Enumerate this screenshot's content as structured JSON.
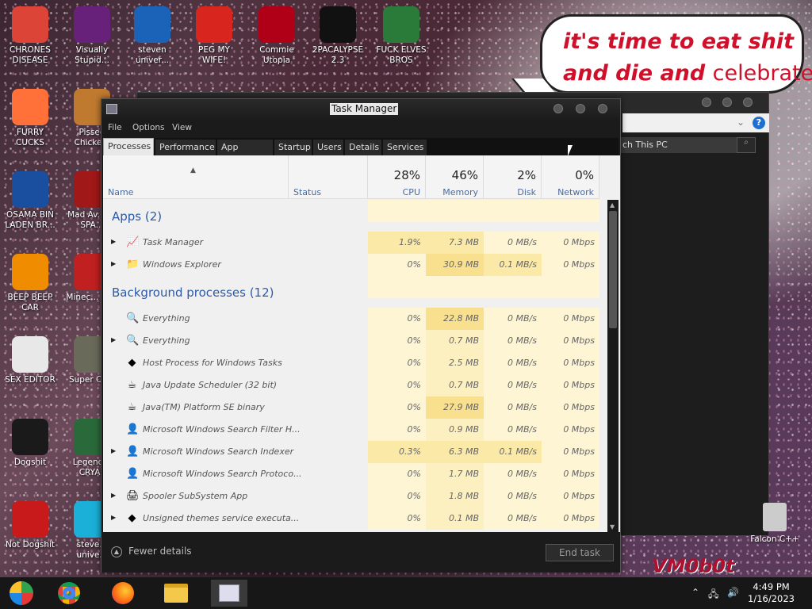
{
  "desktop": {
    "icons": [
      {
        "label": "CHRONES DISEASE",
        "color": "#db4437",
        "glyph": "chrome-icon"
      },
      {
        "label": "Visually Stupid...",
        "color": "#68217a",
        "glyph": "visual-studio-icon"
      },
      {
        "label": "steven univer...",
        "color": "#1a63b8",
        "glyph": "game-icon"
      },
      {
        "label": "PEG MY WIFE!",
        "color": "#d8261e",
        "glyph": "peggle-icon"
      },
      {
        "label": "Commie Utopia",
        "color": "#b00018",
        "glyph": "star-icon"
      },
      {
        "label": "2PACALYPSE 2.3",
        "color": "#111111",
        "glyph": "cmd-icon"
      },
      {
        "label": "FUCK ELVES BROS",
        "color": "#2a7a3a",
        "glyph": "elf-icon"
      },
      {
        "label": "FURRY CUCKS",
        "color": "#ff7139",
        "glyph": "firefox-icon"
      },
      {
        "label": "Pissed Chicke...",
        "color": "#c07a30",
        "glyph": "chicken-icon"
      },
      {
        "label": "OSAMA BIN LADEN BR...",
        "color": "#1a4fa0",
        "glyph": "obama-logo-icon"
      },
      {
        "label": "Mad Av... IN SPA...",
        "color": "#a01818",
        "glyph": "angry-birds-icon"
      },
      {
        "label": "BEEP BEEP CAR",
        "color": "#f08c00",
        "glyph": "vlc-icon"
      },
      {
        "label": "Minec... Bird",
        "color": "#c02020",
        "glyph": "bird-icon"
      },
      {
        "label": "SEX EDITOR",
        "color": "#e8e8e8",
        "glyph": "hxd-icon"
      },
      {
        "label": "Super Ch...",
        "color": "#6a6a5a",
        "glyph": "pixel-icon"
      },
      {
        "label": "Dogshit",
        "color": "#1a1a1a",
        "glyph": "codeblocks-icon"
      },
      {
        "label": "Legend... CRYAL",
        "color": "#2a6a3a",
        "glyph": "zelda-icon"
      },
      {
        "label": "Not Dogshit",
        "color": "#c81a1a",
        "glyph": "devcpp-icon"
      },
      {
        "label": "steve... unive...",
        "color": "#1ab0d8",
        "glyph": "gem-icon"
      }
    ],
    "bubble": {
      "line1": "it's time to eat shit",
      "line2a": "and die and ",
      "line2b": "celebrate"
    },
    "overlay_text": "VM0b0t",
    "falcon_label": "Falcon C++",
    "explorer": {
      "search_placeholder": "ch This PC",
      "search_btn": "⌕",
      "help": "?",
      "chevron": "⌄"
    }
  },
  "taskmanager": {
    "title": "Task Manager",
    "menu": [
      "File",
      "Options",
      "View"
    ],
    "tabs": [
      "Processes",
      "Performance",
      "App history",
      "Startup",
      "Users",
      "Details",
      "Services"
    ],
    "active_tab": "Processes",
    "columns": {
      "name": "Name",
      "status": "Status",
      "cpu": {
        "pct": "28%",
        "label": "CPU"
      },
      "memory": {
        "pct": "46%",
        "label": "Memory"
      },
      "disk": {
        "pct": "2%",
        "label": "Disk"
      },
      "network": {
        "pct": "0%",
        "label": "Network"
      }
    },
    "groups": [
      {
        "title": "Apps (2)",
        "rows": [
          {
            "expand": "▶",
            "icon": "taskmgr-icon",
            "glyph": "📈",
            "name": "Task Manager",
            "cpu": "1.9%",
            "mem": "7.3 MB",
            "disk": "0 MB/s",
            "net": "0 Mbps"
          },
          {
            "expand": "▶",
            "icon": "folder-icon",
            "glyph": "📁",
            "name": "Windows Explorer",
            "cpu": "0%",
            "mem": "30.9 MB",
            "disk": "0.1 MB/s",
            "net": "0 Mbps"
          }
        ]
      },
      {
        "title": "Background processes (12)",
        "rows": [
          {
            "expand": "",
            "icon": "magnifier-icon",
            "glyph": "🔍",
            "name": "Everything",
            "cpu": "0%",
            "mem": "22.8 MB",
            "disk": "0 MB/s",
            "net": "0 Mbps"
          },
          {
            "expand": "▶",
            "icon": "magnifier-icon",
            "glyph": "🔍",
            "name": "Everything",
            "cpu": "0%",
            "mem": "0.7 MB",
            "disk": "0 MB/s",
            "net": "0 Mbps"
          },
          {
            "expand": "",
            "icon": "diamond-icon",
            "glyph": "◆",
            "name": "Host Process for Windows Tasks",
            "cpu": "0%",
            "mem": "2.5 MB",
            "disk": "0 MB/s",
            "net": "0 Mbps"
          },
          {
            "expand": "",
            "icon": "java-icon",
            "glyph": "☕",
            "name": "Java Update Scheduler (32 bit)",
            "cpu": "0%",
            "mem": "0.7 MB",
            "disk": "0 MB/s",
            "net": "0 Mbps"
          },
          {
            "expand": "",
            "icon": "java-icon",
            "glyph": "☕",
            "name": "Java(TM) Platform SE binary",
            "cpu": "0%",
            "mem": "27.9 MB",
            "disk": "0 MB/s",
            "net": "0 Mbps"
          },
          {
            "expand": "",
            "icon": "search-person-icon",
            "glyph": "👤",
            "name": "Microsoft Windows Search Filter H...",
            "cpu": "0%",
            "mem": "0.9 MB",
            "disk": "0 MB/s",
            "net": "0 Mbps"
          },
          {
            "expand": "▶",
            "icon": "search-person-icon",
            "glyph": "👤",
            "name": "Microsoft Windows Search Indexer",
            "cpu": "0.3%",
            "mem": "6.3 MB",
            "disk": "0.1 MB/s",
            "net": "0 Mbps"
          },
          {
            "expand": "",
            "icon": "search-person-icon",
            "glyph": "👤",
            "name": "Microsoft Windows Search Protoco...",
            "cpu": "0%",
            "mem": "1.7 MB",
            "disk": "0 MB/s",
            "net": "0 Mbps"
          },
          {
            "expand": "▶",
            "icon": "printer-icon",
            "glyph": "🖨",
            "name": "Spooler SubSystem App",
            "cpu": "0%",
            "mem": "1.8 MB",
            "disk": "0 MB/s",
            "net": "0 Mbps"
          },
          {
            "expand": "▶",
            "icon": "diamond-icon",
            "glyph": "◆",
            "name": "Unsigned themes service executa...",
            "cpu": "0%",
            "mem": "0.1 MB",
            "disk": "0 MB/s",
            "net": "0 Mbps"
          }
        ]
      }
    ],
    "footer": {
      "fewer_details": "Fewer details",
      "fewer_glyph": "▲",
      "end_task": "End task"
    }
  },
  "taskbar": {
    "items": [
      "start-button",
      "chrome",
      "firefox",
      "file-explorer",
      "task-manager"
    ],
    "clock_time": "4:49 PM",
    "clock_date": "1/16/2023"
  }
}
